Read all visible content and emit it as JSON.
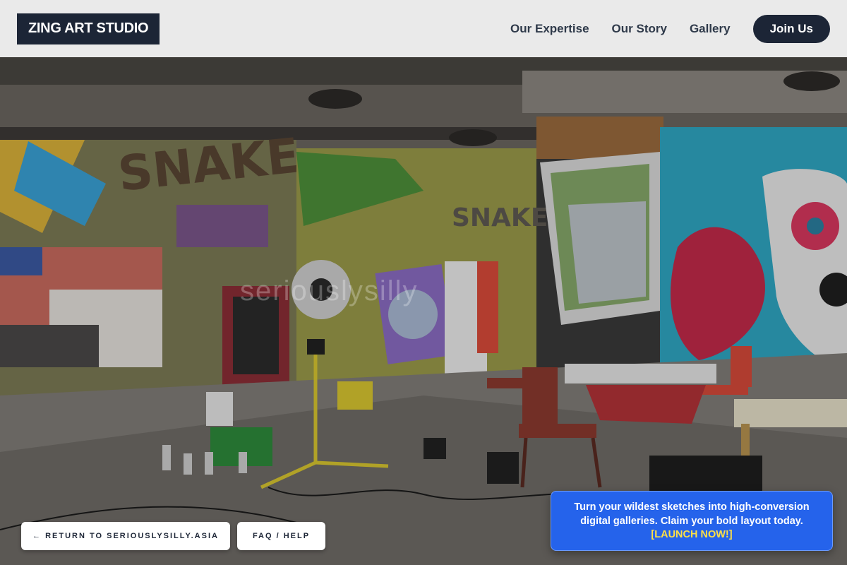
{
  "header": {
    "logo": "ZING ART STUDIO",
    "nav": [
      "Our Expertise",
      "Our Story",
      "Gallery"
    ],
    "cta": "Join Us"
  },
  "hero": {
    "background": "graffiti-art-studio-photo",
    "watermark": "seriouslysilly"
  },
  "footer_buttons": {
    "return_label": "← RETURN TO SERIOUSLYSILLY.ASIA",
    "faq_label": "FAQ / HELP"
  },
  "promo": {
    "text": "Turn your wildest sketches into high-conversion digital galleries. Claim your bold layout today.",
    "cta": "[LAUNCH NOW!]"
  },
  "colors": {
    "brand_dark": "#1c2536",
    "promo_blue": "#2563eb",
    "promo_cta": "#fde047"
  }
}
